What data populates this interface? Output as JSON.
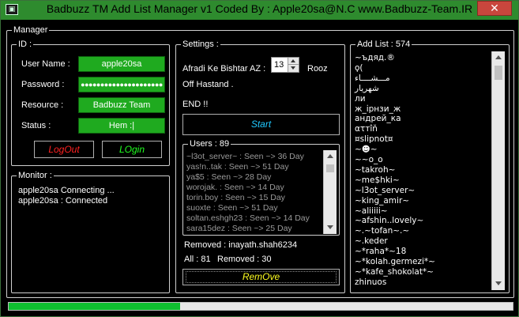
{
  "window": {
    "title": "Badbuzz TM Add List Manager v1 Coded By : Apple20sa@N.C www.Badbuzz-Team.IR",
    "close_glyph": "✕",
    "app_icon": "app-icon"
  },
  "manager": {
    "legend": "Manager"
  },
  "id_group": {
    "legend": "ID :",
    "username_label": "User Name :",
    "username_value": "apple20sa",
    "password_label": "Password :",
    "password_value": "●●●●●●●●●●●●●●●●●●●●●",
    "resource_label": "Resource :",
    "resource_value": "Badbuzz Team",
    "status_label": "Status :",
    "status_value": "Hem :|",
    "logout_label": "LogOut",
    "login_label": "LOgin"
  },
  "monitor": {
    "legend": "Monitor :",
    "lines": [
      "apple20sa Connecting ...",
      "apple20sa : Connected"
    ]
  },
  "settings": {
    "legend": "Settings :",
    "afradi_label": "Afradi Ke Bishtar AZ :",
    "days_value": "13",
    "rooz_label": "Rooz",
    "off_label": "Off Hastand .",
    "end_label": "END !!",
    "start_label": "Start"
  },
  "users": {
    "legend": "Users : 89",
    "items": [
      "~l3ot_server~ : Seen ~> 36 Day",
      "yas!n..tak : Seen ~> 51 Day",
      "ya$5 : Seen ~> 28 Day",
      "worojak. : Seen ~> 14 Day",
      "torin.boy : Seen ~> 15 Day",
      "suoxte : Seen ~> 51 Day",
      "soltan.eshgh23 : Seen ~> 14 Day",
      "sara15dez : Seen ~> 25 Day"
    ],
    "removed_line": "Removed : inayath.shah6234",
    "all_line": "All : 81",
    "removed_count_line": "Removed : 30",
    "remove_button": "RemOve"
  },
  "add_list": {
    "legend": "Add List : 574",
    "items": [
      "~ъдяд.®",
      "ϙ(",
      "مـــشــــاء",
      "شهريار",
      "ли",
      "ж_ірнзи_ж",
      "андрей_ка",
      "ατтîň",
      "¤slipnot¤",
      "~☻~",
      "~~o_o",
      "~takroh~",
      "~me$hki~",
      "~l3ot_server~",
      "~king_amir~",
      "~aliiiii~",
      "~afshin..lovely~",
      "~.~tofan~.~",
      "~.keder",
      "~*raha*~18",
      "~*kolah.germezi*~",
      "~*kafe_shokolat*~",
      "zhinuos"
    ]
  },
  "progress": {
    "fraction": 0.34,
    "color": "#0fbf30"
  },
  "colors": {
    "titlebar": "#2e8b2e",
    "field_green": "#1faa1f",
    "logout_red": "#ff2020",
    "login_green": "#20ff20",
    "start_cyan": "#20c8ff",
    "remove_yellow": "#ffff20"
  }
}
